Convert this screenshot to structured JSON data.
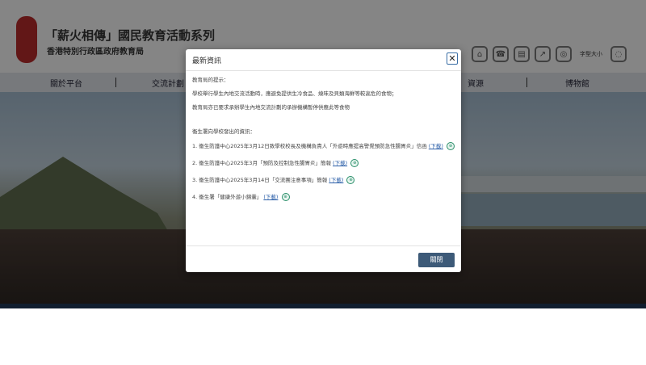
{
  "header": {
    "title": "「薪火相傳」國民教育活動系列",
    "subtitle": "香港特別行政區政府教育局",
    "font_size_label": "字型大小"
  },
  "toolbar_icons": [
    "home-icon",
    "phone-icon",
    "book-icon",
    "share-icon",
    "globe-icon",
    "chat-icon"
  ],
  "nav": {
    "items": [
      {
        "label": "關於平台"
      },
      {
        "label": "交流計劃"
      },
      {
        "label": "資源"
      },
      {
        "label": "博物館"
      }
    ]
  },
  "modal": {
    "title": "最新資訊",
    "close_symbol": "✕",
    "reminder_heading": "教育局的提示：",
    "reminder_1": "學校舉行學生內地交流活動時，應避免提供生冷食品、燒味及貝類海鮮等較高危的食物；",
    "reminder_2": "教育局亦已要求承辦學生內地交流計劃的承辦機構暫停供應此等食物",
    "health_heading": "衞生署向學校發出的資訊：",
    "items": [
      {
        "text": "1. 衞生防護中心2025年3月12日致學校校長及機構負責人「外遊時應提高警覺預防急性腸胃炎」信函",
        "link": "(下載)"
      },
      {
        "text": "2. 衞生防護中心2025年3月「預防及控制急性腸胃炎」簡報",
        "link": "(下載)"
      },
      {
        "text": "3. 衞生防護中心2025年3月14日「交流團注意事項」簡報",
        "link": "(下載)"
      },
      {
        "text": "4. 衞生署「健康外遊小錦囊」",
        "link": "(下載)"
      }
    ],
    "close_button": "關閉"
  },
  "colors": {
    "nav_bg": "#d9dde2",
    "footer_bar": "#1f3856",
    "close_button_bg": "#3d5a78",
    "link": "#2a5ea8",
    "download_icon": "#2a8f6a"
  }
}
